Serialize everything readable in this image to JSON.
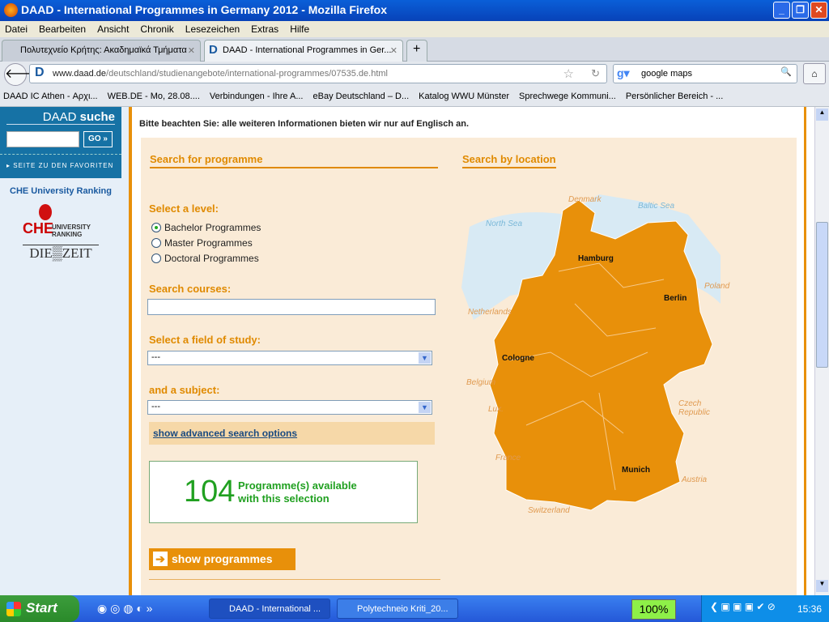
{
  "window": {
    "title": "DAAD - International Programmes in Germany 2012 - Mozilla Firefox"
  },
  "menu": [
    "Datei",
    "Bearbeiten",
    "Ansicht",
    "Chronik",
    "Lesezeichen",
    "Extras",
    "Hilfe"
  ],
  "tabs": [
    {
      "label": "Πολυτεχνείο Κρήτης: Ακαδημαϊκά Τμήματα"
    },
    {
      "label": "DAAD - International Programmes in Ger..."
    }
  ],
  "nav": {
    "url_host": "www.daad.de",
    "url_path": "/deutschland/studienangebote/international-programmes/07535.de.html",
    "search": "google maps"
  },
  "bookmarks": [
    "DAAD IC Athen - Αρχι...",
    "WEB.DE - Mo, 28.08....",
    "Verbindungen - Ihre A...",
    "eBay Deutschland – D...",
    "Katalog WWU Münster",
    "Sprechwege Kommuni...",
    "Persönlicher Bereich - ..."
  ],
  "sidebar": {
    "search_title_a": "DAAD",
    "search_title_b": "suche",
    "go": "GO »",
    "favorites": "SEITE ZU DEN FAVORITEN",
    "che_link": "CHE University Ranking",
    "che_logo": "CHE UNIVERSITY RANKING",
    "zeit_logo": "DIE ZEIT"
  },
  "main": {
    "notice": "Bitte beachten Sie: alle weiteren Informationen bieten wir nur auf Englisch an.",
    "search_heading": "Search for programme",
    "location_heading": "Search by location",
    "level_label": "Select a level:",
    "levels": [
      {
        "label": "Bachelor Programmes",
        "checked": true
      },
      {
        "label": "Master Programmes",
        "checked": false
      },
      {
        "label": "Doctoral Programmes",
        "checked": false
      }
    ],
    "courses_label": "Search courses:",
    "courses_value": "",
    "field_label": "Select a field of study:",
    "field_value": "---",
    "subject_label": "and a subject:",
    "subject_value": "---",
    "advanced": "show advanced search options",
    "count": "104",
    "count_text_1": "Programme(s) available",
    "count_text_2": "with this selection",
    "show_button": "show programmes"
  },
  "map": {
    "seas": [
      "North Sea",
      "Baltic Sea"
    ],
    "countries": [
      "Denmark",
      "Poland",
      "Netherlands",
      "Belgium",
      "Lux.",
      "France",
      "Czech Republic",
      "Austria",
      "Switzerland"
    ],
    "cities": [
      "Hamburg",
      "Berlin",
      "Cologne",
      "Munich"
    ],
    "land_color": "#e8900a",
    "sea_color": "#d8eaf4"
  },
  "taskbar": {
    "start": "Start",
    "tasks": [
      "DAAD - International ...",
      "Polytechneio Kriti_20..."
    ],
    "battery": "100%",
    "clock": "15:36"
  }
}
